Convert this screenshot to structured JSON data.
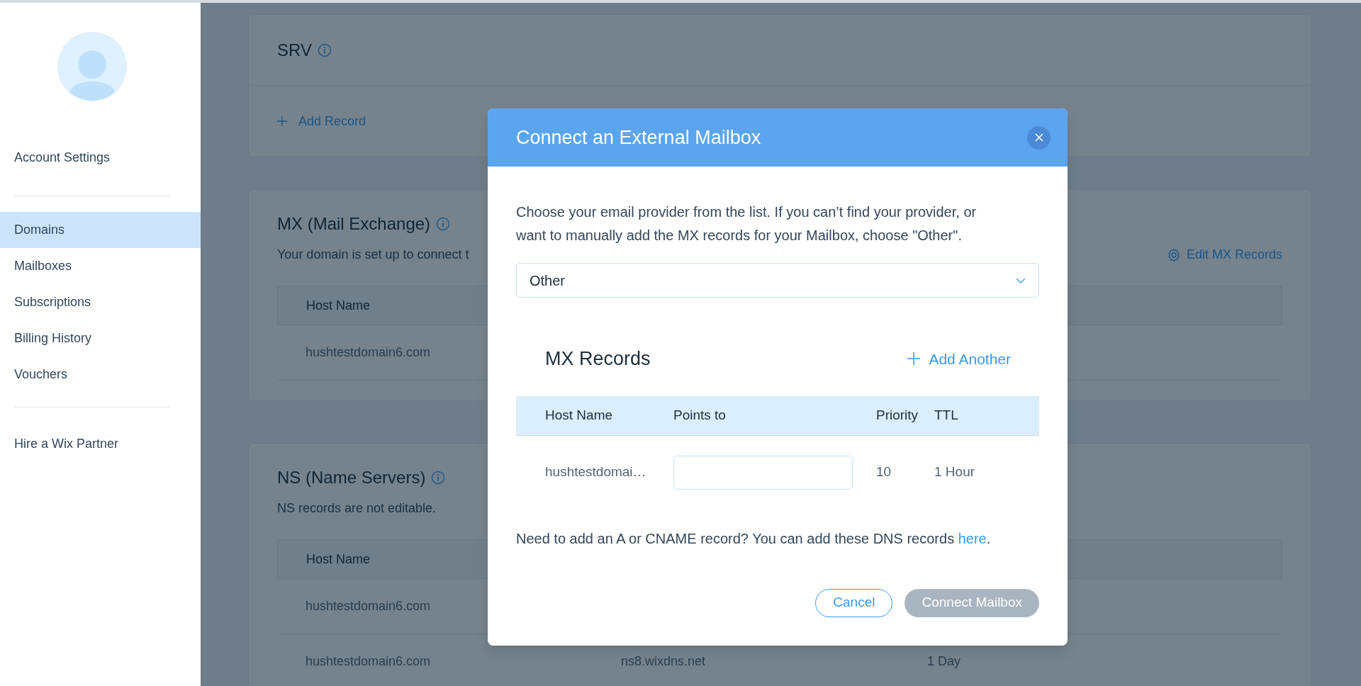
{
  "sidebar": {
    "account_link": "Account Settings",
    "items": [
      {
        "label": "Domains",
        "selected": true
      },
      {
        "label": "Mailboxes",
        "selected": false
      },
      {
        "label": "Subscriptions",
        "selected": false
      },
      {
        "label": "Billing History",
        "selected": false
      },
      {
        "label": "Vouchers",
        "selected": false
      }
    ],
    "partner_link": "Hire a Wix Partner"
  },
  "background": {
    "srv": {
      "title": "SRV",
      "add_record": "Add Record"
    },
    "mx": {
      "title": "MX (Mail Exchange)",
      "description": "Your domain is set up to connect t",
      "edit_link": "Edit MX Records",
      "columns": [
        "Host Name"
      ],
      "rows": [
        [
          "hushtestdomain6.com"
        ]
      ]
    },
    "ns": {
      "title": "NS (Name Servers)",
      "description": "NS records are not editable.",
      "columns": [
        "Host Name"
      ],
      "rows": [
        [
          "hushtestdomain6.com"
        ],
        [
          "hushtestdomain6.com",
          "ns8.wixdns.net",
          "1 Day"
        ]
      ]
    }
  },
  "modal": {
    "title": "Connect an External Mailbox",
    "intro": "Choose your email provider from the list. If you can’t find your provider, or want to manually add the MX records for your Mailbox, choose \"Other\".",
    "provider_select": {
      "value": "Other"
    },
    "mx_records": {
      "title": "MX Records",
      "add_button": "Add Another",
      "columns": [
        "Host Name",
        "Points to",
        "Priority",
        "TTL"
      ],
      "rows": [
        {
          "host": "hushtestdomai…",
          "priority": "10",
          "ttl": "1 Hour"
        }
      ]
    },
    "note": {
      "text": "Need to add an A or CNAME record? You can add these DNS records ",
      "link": "here",
      "after": "."
    },
    "buttons": [
      {
        "label": "Cancel",
        "kind": "outline",
        "disabled": false
      },
      {
        "label": "Connect Mailbox",
        "kind": "primary",
        "disabled": true
      }
    ]
  }
}
